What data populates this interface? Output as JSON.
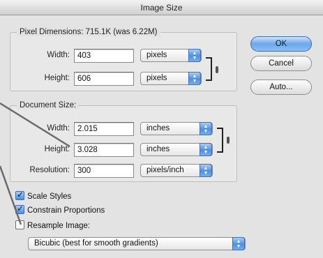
{
  "window": {
    "title": "Image Size"
  },
  "pixel_dimensions": {
    "legend": "Pixel Dimensions:  715.1K (was 6.22M)",
    "width_label": "Width:",
    "width_value": "403",
    "width_unit": "pixels",
    "height_label": "Height:",
    "height_value": "606",
    "height_unit": "pixels"
  },
  "document_size": {
    "legend": "Document Size:",
    "width_label": "Width:",
    "width_value": "2.015",
    "width_unit": "inches",
    "height_label": "Height:",
    "height_value": "3.028",
    "height_unit": "inches",
    "resolution_label": "Resolution:",
    "resolution_value": "300",
    "resolution_unit": "pixels/inch"
  },
  "options": {
    "scale_styles": {
      "label": "Scale Styles",
      "checked": true
    },
    "constrain_proportions": {
      "label": "Constrain Proportions",
      "checked": true
    },
    "resample_image": {
      "label": "Resample Image:",
      "checked": false
    },
    "resample_method": "Bicubic (best for smooth gradients)"
  },
  "buttons": {
    "ok": "OK",
    "cancel": "Cancel",
    "auto": "Auto..."
  },
  "colors": {
    "accent": "#5b9be6",
    "pointer_line": "#6b6b6b"
  }
}
